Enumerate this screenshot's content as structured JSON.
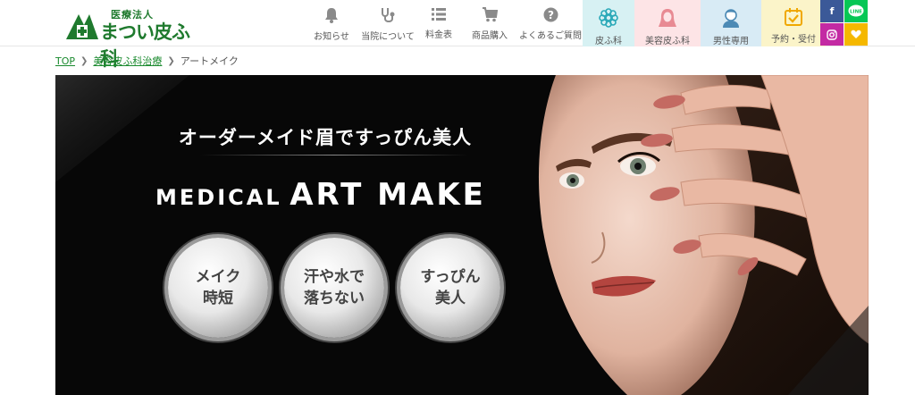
{
  "logo": {
    "small_text": "医療法人",
    "main_text": "まつい皮ふ科"
  },
  "nav": [
    {
      "label": "お知らせ",
      "icon": "bell-icon"
    },
    {
      "label": "当院について",
      "icon": "stethoscope-icon"
    },
    {
      "label": "料金表",
      "icon": "list-icon"
    },
    {
      "label": "商品購入",
      "icon": "cart-icon"
    },
    {
      "label": "よくあるご質問",
      "icon": "question-icon"
    },
    {
      "label": "皮ふ科",
      "icon": "flower-icon"
    },
    {
      "label": "美容皮ふ科",
      "icon": "woman-icon"
    },
    {
      "label": "男性専用",
      "icon": "man-icon"
    },
    {
      "label": "予約・受付",
      "icon": "calendar-check-icon"
    }
  ],
  "nav_colors": {
    "skin": "#d7f1f3",
    "beauty": "#fde4e6",
    "men": "#d8ebf5",
    "reserve": "#fbf4c9"
  },
  "social": {
    "facebook": {
      "label": "f",
      "color": "#3b5998"
    },
    "line": {
      "label": "LINE",
      "color": "#06c755"
    },
    "instagram": {
      "label": "instagram-icon",
      "color": "#c32aa3"
    },
    "favorite": {
      "label": "heart-icon",
      "color": "#f5b800"
    }
  },
  "breadcrumb": {
    "home": "TOP",
    "parent": "美容皮ふ科治療",
    "current": "アートメイク"
  },
  "hero": {
    "subtitle": "オーダーメイド眉ですっぴん美人",
    "title_small": "MEDICAL",
    "title_big": "ART MAKE",
    "badges": [
      "メイク\n時短",
      "汗や水で\n落ちない",
      "すっぴん\n美人"
    ]
  }
}
